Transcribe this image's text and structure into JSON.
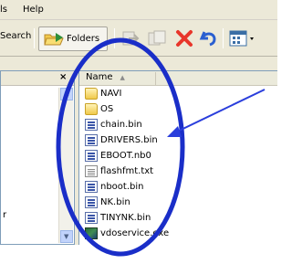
{
  "menu": {
    "tools_fragment": "ls",
    "help": "Help"
  },
  "toolbar": {
    "search_fragment": "Search",
    "folders": "Folders"
  },
  "left_pane": {
    "close_glyph": "×",
    "edge_glyph": "r"
  },
  "columns": {
    "name": "Name",
    "sort": "▲"
  },
  "files": [
    {
      "name": "NAVI",
      "type": "folder"
    },
    {
      "name": "OS",
      "type": "folder"
    },
    {
      "name": "chain.bin",
      "type": "bin"
    },
    {
      "name": "DRIVERS.bin",
      "type": "bin"
    },
    {
      "name": "EBOOT.nb0",
      "type": "bin"
    },
    {
      "name": "flashfmt.txt",
      "type": "txt"
    },
    {
      "name": "nboot.bin",
      "type": "bin"
    },
    {
      "name": "NK.bin",
      "type": "bin"
    },
    {
      "name": "TINYNK.bin",
      "type": "bin"
    },
    {
      "name": "vdoservice.exe",
      "type": "exe"
    }
  ],
  "icons": {
    "folders_button": "folder-icon",
    "move_to": "move-to-icon",
    "copy_to": "copy-to-icon",
    "delete": "delete-icon",
    "undo": "undo-icon",
    "views": "views-icon"
  },
  "colors": {
    "highlight_ellipse": "#1a2ec8",
    "arrow": "#2a3edc",
    "delete_x": "#e8362b",
    "undo": "#2a5fd0"
  }
}
